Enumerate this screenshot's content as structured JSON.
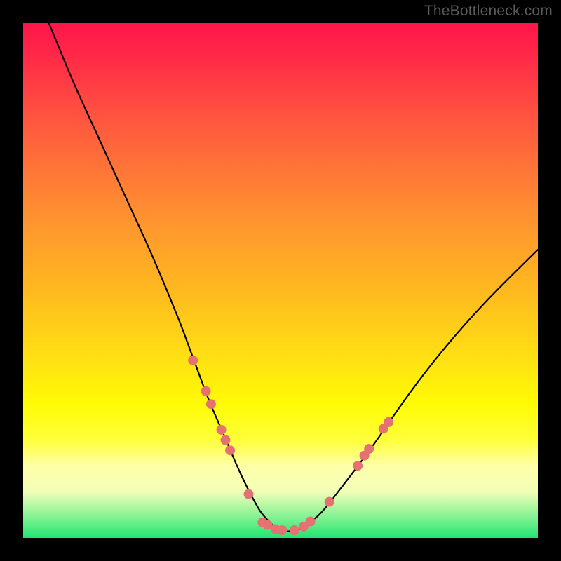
{
  "watermark": "TheBottleneck.com",
  "chart_data": {
    "type": "line",
    "title": "",
    "xlabel": "",
    "ylabel": "",
    "xlim": [
      0,
      100
    ],
    "ylim": [
      0,
      100
    ],
    "grid": false,
    "curve": {
      "name": "bottleneck-curve",
      "x": [
        5,
        10,
        15,
        20,
        25,
        30,
        33,
        36,
        39,
        42,
        45,
        47,
        50,
        53,
        55,
        58,
        62,
        68,
        75,
        82,
        90,
        100
      ],
      "y": [
        100,
        88,
        77,
        66,
        55,
        43,
        35,
        27,
        20,
        13,
        7,
        4,
        1.5,
        1.5,
        2.5,
        5,
        10,
        18,
        28,
        37,
        46,
        56
      ]
    },
    "markers": {
      "name": "highlight-points",
      "color": "#e57272",
      "points": [
        {
          "x": 33.0,
          "y": 34.5
        },
        {
          "x": 35.5,
          "y": 28.5
        },
        {
          "x": 36.5,
          "y": 26.0
        },
        {
          "x": 38.5,
          "y": 21.0
        },
        {
          "x": 39.3,
          "y": 19.0
        },
        {
          "x": 40.2,
          "y": 17.0
        },
        {
          "x": 43.8,
          "y": 8.5
        },
        {
          "x": 46.5,
          "y": 3.0
        },
        {
          "x": 47.5,
          "y": 2.5
        },
        {
          "x": 49.0,
          "y": 1.7
        },
        {
          "x": 50.3,
          "y": 1.5
        },
        {
          "x": 52.7,
          "y": 1.5
        },
        {
          "x": 54.5,
          "y": 2.2
        },
        {
          "x": 55.8,
          "y": 3.2
        },
        {
          "x": 59.5,
          "y": 7.0
        },
        {
          "x": 65.0,
          "y": 14.0
        },
        {
          "x": 66.3,
          "y": 16.0
        },
        {
          "x": 67.2,
          "y": 17.3
        },
        {
          "x": 70.0,
          "y": 21.2
        },
        {
          "x": 71.0,
          "y": 22.5
        }
      ]
    },
    "background_gradient": {
      "top": "#ff154a",
      "mid": "#ffe312",
      "bottom": "#20e472"
    }
  }
}
